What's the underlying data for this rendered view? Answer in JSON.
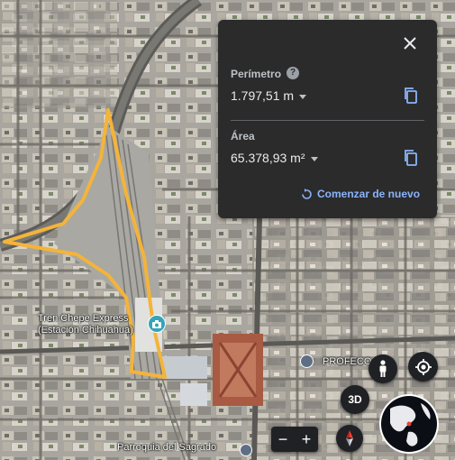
{
  "map": {
    "places": [
      {
        "name": "Tren Chepe Express",
        "sub": "(Estación Chihuahua)"
      },
      {
        "name": "PROFECO"
      },
      {
        "name": "Parroquia del Sagrado"
      }
    ],
    "measurement_color": "#f4b43a",
    "pin_color": "#34a4b8"
  },
  "panel": {
    "perimeter_label": "Perímetro",
    "perimeter_value": "1.797,51 m",
    "area_label": "Área",
    "area_value": "65.378,93 m²",
    "restart_label": "Comenzar de nuevo"
  },
  "controls": {
    "zoom_out": "−",
    "zoom_in": "+",
    "view_3d": "3D"
  },
  "icons": [
    "close-icon",
    "help-icon",
    "copy-icon",
    "restart-icon",
    "pegman-icon",
    "my-location-icon",
    "compass-icon",
    "globe-icon",
    "camera-pin-icon"
  ]
}
